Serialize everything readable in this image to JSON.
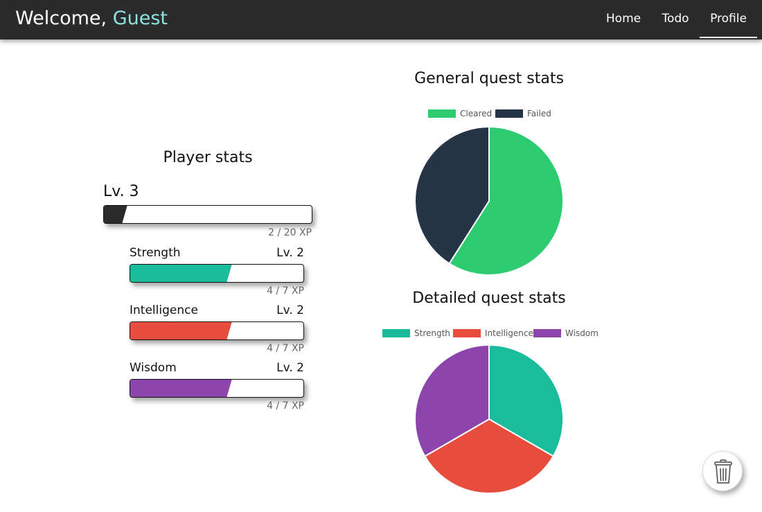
{
  "navbar": {
    "welcome": "Welcome,",
    "username": "Guest",
    "links": {
      "home": "Home",
      "todo": "Todo",
      "profile": "Profile"
    },
    "active_link": "Profile"
  },
  "player_stats": {
    "title": "Player stats",
    "level": "Lv. 3",
    "xp": "2 / 20 XP",
    "xp_fraction": 0.1,
    "bar_color": "#2b2b2b",
    "stats": [
      {
        "name": "Strength",
        "level": "Lv. 2",
        "xp": "4 / 7 XP",
        "xp_fraction": 0.571,
        "color": "#1abc9c"
      },
      {
        "name": "Intelligence",
        "level": "Lv. 2",
        "xp": "4 / 7 XP",
        "xp_fraction": 0.571,
        "color": "#e74c3c"
      },
      {
        "name": "Wisdom",
        "level": "Lv. 2",
        "xp": "4 / 7 XP",
        "xp_fraction": 0.571,
        "color": "#8e44ad"
      }
    ]
  },
  "chart_data": [
    {
      "type": "pie",
      "title": "General quest stats",
      "categories": [
        "Cleared",
        "Failed"
      ],
      "values": [
        59,
        41
      ],
      "colors": [
        "#2ecc71",
        "#253447"
      ],
      "legend": "top"
    },
    {
      "type": "pie",
      "title": "Detailed quest stats",
      "categories": [
        "Strength",
        "Intelligence",
        "Wisdom"
      ],
      "values": [
        1,
        1,
        1
      ],
      "colors": [
        "#1abc9c",
        "#e74c3c",
        "#8e44ad"
      ],
      "legend": "top"
    }
  ],
  "fab": {
    "icon": "trash-icon"
  }
}
